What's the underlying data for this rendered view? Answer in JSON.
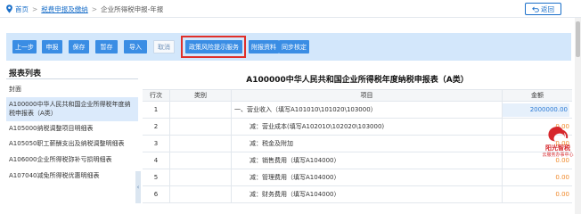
{
  "breadcrumb": {
    "home": "首页",
    "sep1": ">",
    "section": "税费申报及缴纳",
    "sep2": ">",
    "current": "企业所得税申报-年报"
  },
  "back_label": "返回",
  "toolbar": {
    "prev": "上一步",
    "submit": "申报",
    "save": "保存",
    "temp_save": "暂存",
    "import": "导入",
    "cancel": "取消",
    "policy": "政策风险提示服务",
    "attachment": "附报资料",
    "sync": "同步核定"
  },
  "sidebar": {
    "title": "报表列表",
    "items": [
      "封面",
      "A100000中华人民共和国企业所得税年度纳",
      "税申报表（A类）",
      "A105000纳税调整项目明细表",
      "A105050职工薪酬支出及纳税调整明细表",
      "A106000企业所得税弥补亏损明细表",
      "A107040减免所得税优惠明细表"
    ],
    "collapse_glyph": "‹"
  },
  "report": {
    "title": "A100000中华人民共和国企业所得税年度纳税申报表（A类）",
    "headers": {
      "no": "行次",
      "category": "类别",
      "item": "项目",
      "amount": "金额"
    },
    "rows": [
      {
        "no": "1",
        "category": "",
        "item": "一、营业收入（填写A101010\\101020\\103000）",
        "amount": "2000000.00"
      },
      {
        "no": "2",
        "category": "",
        "item": "减：营业成本(填写A102010\\102020\\103000)",
        "amount": "0.00"
      },
      {
        "no": "3",
        "category": "",
        "item": "减：税金及附加",
        "amount": "0.00"
      },
      {
        "no": "4",
        "category": "",
        "item": "减：销售费用（填写A104000）",
        "amount": "0.00"
      },
      {
        "no": "5",
        "category": "",
        "item": "减：管理费用（填写A104000）",
        "amount": "0.00"
      },
      {
        "no": "6",
        "category": "",
        "item": "减：财务费用（填写A104000）",
        "amount": "0.00"
      }
    ]
  },
  "logo": {
    "name": "阳光智税",
    "subtitle": "云服务办事中心"
  },
  "colors": {
    "primary": "#3a8de4",
    "highlight": "#e0302a",
    "toolbar_bg": "#d3e7fb",
    "link": "#1a6fc9"
  }
}
